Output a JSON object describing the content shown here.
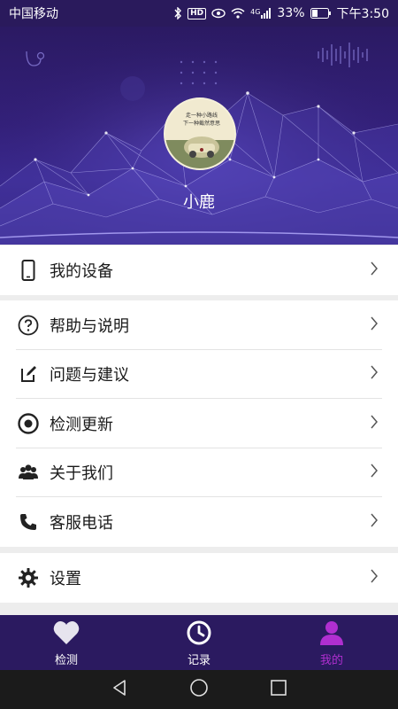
{
  "status_bar": {
    "carrier": "中国移动",
    "hd": "HD",
    "network": "4G",
    "battery": "33%",
    "time": "下午3:50"
  },
  "profile": {
    "name": "小鹿"
  },
  "menu": {
    "group1": [
      {
        "label": "我的设备",
        "icon": "phone-icon"
      }
    ],
    "group2": [
      {
        "label": "帮助与说明",
        "icon": "question-icon"
      },
      {
        "label": "问题与建议",
        "icon": "edit-icon"
      },
      {
        "label": "检测更新",
        "icon": "target-icon"
      },
      {
        "label": "关于我们",
        "icon": "people-icon"
      },
      {
        "label": "客服电话",
        "icon": "telephone-icon"
      }
    ],
    "group3": [
      {
        "label": "设置",
        "icon": "gear-icon"
      }
    ]
  },
  "tabs": [
    {
      "label": "检测",
      "icon": "heart-icon",
      "active": false
    },
    {
      "label": "记录",
      "icon": "clock-icon",
      "active": false
    },
    {
      "label": "我的",
      "icon": "person-icon",
      "active": true
    }
  ],
  "colors": {
    "header_bg": "#33207a",
    "tab_bar_bg": "#2b1a60",
    "tab_active": "#b02fd0"
  }
}
